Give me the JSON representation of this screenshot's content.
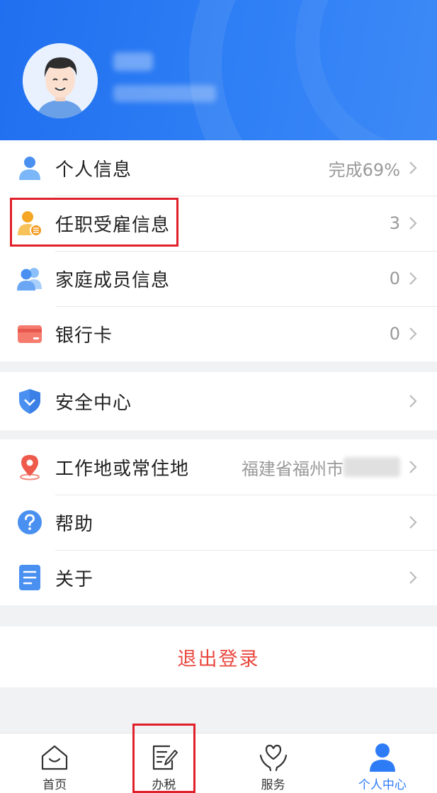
{
  "header": {
    "user_name": "",
    "user_phone": ""
  },
  "group1": {
    "items": [
      {
        "label": "个人信息",
        "value": "完成69%"
      },
      {
        "label": "任职受雇信息",
        "value": "3"
      },
      {
        "label": "家庭成员信息",
        "value": "0"
      },
      {
        "label": "银行卡",
        "value": "0"
      }
    ]
  },
  "group2": {
    "items": [
      {
        "label": "安全中心",
        "value": ""
      }
    ]
  },
  "group3": {
    "items": [
      {
        "label": "工作地或常住地",
        "value": "福建省福州市"
      },
      {
        "label": "帮助",
        "value": ""
      },
      {
        "label": "关于",
        "value": ""
      }
    ]
  },
  "logout": {
    "label": "退出登录"
  },
  "tabbar": {
    "tabs": [
      {
        "label": "首页",
        "icon": "home-icon"
      },
      {
        "label": "办税",
        "icon": "tax-form-icon"
      },
      {
        "label": "服务",
        "icon": "heart-hands-icon"
      },
      {
        "label": "个人中心",
        "icon": "person-icon",
        "active": true
      }
    ]
  },
  "colors": {
    "accent": "#2d7cf6",
    "danger": "#e8473e",
    "header_blue": "#1f6ff0"
  }
}
